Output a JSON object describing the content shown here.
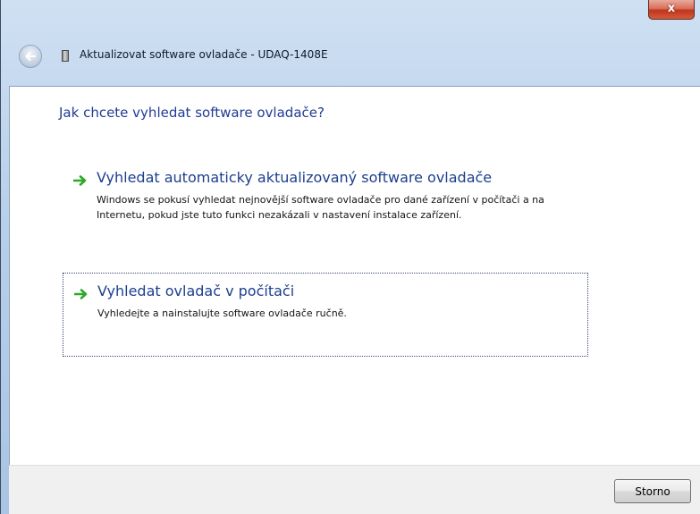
{
  "window": {
    "title": "Aktualizovat software ovladače - UDAQ-1408E",
    "close_label": "x"
  },
  "heading": "Jak chcete vyhledat software ovladače?",
  "options": [
    {
      "title": "Vyhledat automaticky aktualizovaný software ovladače",
      "description": "Windows se pokusí vyhledat nejnovější software ovladače pro dané zařízení v počítači a na Internetu, pokud jste tuto funkci nezakázali v nastavení instalace zařízení.",
      "focused": false
    },
    {
      "title": "Vyhledat ovladač v počítači",
      "description": "Vyhledejte a nainstalujte software ovladače ručně.",
      "focused": true
    }
  ],
  "footer": {
    "cancel_label": "Storno"
  },
  "icons": {
    "back": "back-arrow-icon",
    "device": "device-icon",
    "option_arrow": "green-arrow-icon"
  },
  "colors": {
    "link_blue": "#1c3f8e",
    "arrow_green": "#2fa82a",
    "close_red": "#c2331d"
  }
}
